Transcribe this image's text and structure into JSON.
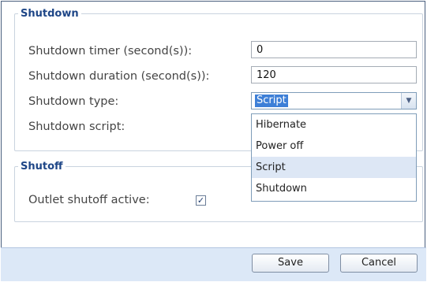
{
  "shutdown": {
    "legend": "Shutdown",
    "timer_label": "Shutdown timer (second(s)):",
    "timer_value": "0",
    "duration_label": "Shutdown duration (second(s)):",
    "duration_value": "120",
    "type_label": "Shutdown type:",
    "type_value": "Script",
    "script_label": "Shutdown script:",
    "type_options": [
      "Hibernate",
      "Power off",
      "Script",
      "Shutdown"
    ],
    "selected_option": "Script"
  },
  "shutoff": {
    "legend": "Shutoff",
    "outlet_label": "Outlet shutoff active:",
    "outlet_checked": true
  },
  "buttons": {
    "save": "Save",
    "cancel": "Cancel"
  },
  "colors": {
    "legend": "#1e4687",
    "selection": "#3d7fd7",
    "footer_bg": "#dce8f7"
  }
}
